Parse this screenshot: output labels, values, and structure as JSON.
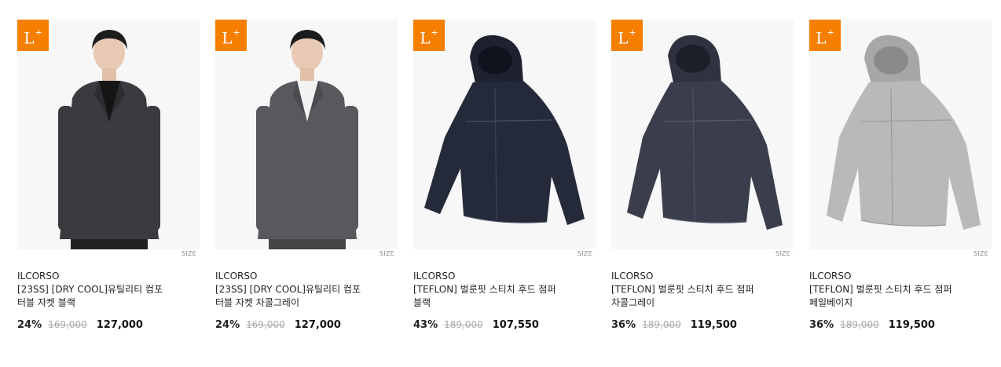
{
  "badge_label": "L",
  "badge_sup": "+",
  "accent_color": "#f77f00",
  "products": [
    {
      "image_icon": "blazer-charcoal-model",
      "size_label": "SIZE",
      "brand": "ILCORSO",
      "name_line1": "[23SS] [DRY COOL]유틸리티 컴포",
      "name_line2": "터블 자켓 블랙",
      "discount": "24%",
      "original_price": "169,000",
      "sale_price": "127,000"
    },
    {
      "image_icon": "blazer-gray-model",
      "size_label": "SIZE",
      "brand": "ILCORSO",
      "name_line1": "[23SS] [DRY COOL]유틸리티 컴포",
      "name_line2": "터블 자켓 차콜그레이",
      "discount": "24%",
      "original_price": "169,000",
      "sale_price": "127,000"
    },
    {
      "image_icon": "hooded-jumper-black",
      "size_label": "SIZE",
      "brand": "ILCORSO",
      "name_line1": "[TEFLON] 벌룬핏 스티치 후드 점퍼",
      "name_line2": "블랙",
      "discount": "43%",
      "original_price": "189,000",
      "sale_price": "107,550"
    },
    {
      "image_icon": "hooded-jumper-charcoal",
      "size_label": "SIZE",
      "brand": "ILCORSO",
      "name_line1": "[TEFLON] 벌룬핏 스티치 후드 점퍼",
      "name_line2": "차콜그레이",
      "discount": "36%",
      "original_price": "189,000",
      "sale_price": "119,500"
    },
    {
      "image_icon": "hooded-jumper-beige",
      "size_label": "SIZE",
      "brand": "ILCORSO",
      "name_line1": "[TEFLON] 벌룬핏 스티치 후드 점퍼",
      "name_line2": "페일베이지",
      "discount": "36%",
      "original_price": "189,000",
      "sale_price": "119,500"
    }
  ]
}
